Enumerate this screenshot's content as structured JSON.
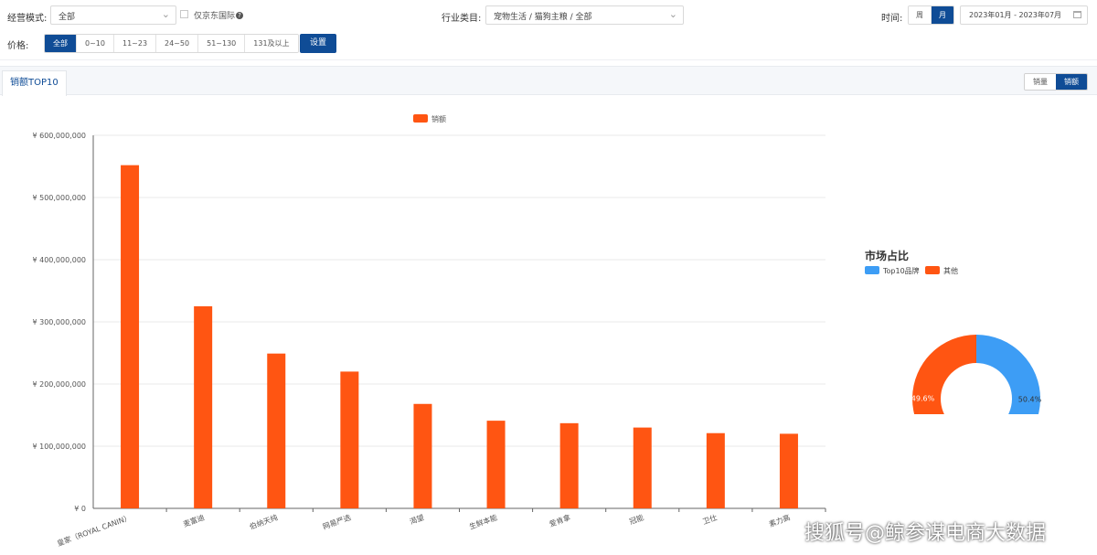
{
  "filters": {
    "mode_label": "经营模式:",
    "mode_value": "全部",
    "jd_intl_label": "仅京东国际",
    "industry_label": "行业类目:",
    "industry_value": "宠物生活 / 猫狗主粮 / 全部",
    "time_label": "时间:",
    "time_options": [
      "周",
      "月"
    ],
    "time_active": "月",
    "date_range": "2023年01月 - 2023年07月",
    "price_label": "价格:",
    "price_options": [
      "全部",
      "0~10",
      "11~23",
      "24~50",
      "51~130",
      "131及以上"
    ],
    "price_active": "全部",
    "set_button": "设置"
  },
  "panel": {
    "tab_label": "销额TOP10",
    "metric_options": [
      "销量",
      "销额"
    ],
    "metric_active": "销额"
  },
  "chart_data": [
    {
      "type": "bar",
      "legend": [
        "销额"
      ],
      "legend_position": "top-center",
      "categories": [
        "皇家（ROYAL CANIN）",
        "麦富迪",
        "伯纳天纯",
        "网易严选",
        "渴望",
        "生鲜本能",
        "爱肯拿",
        "冠能",
        "卫仕",
        "素力高"
      ],
      "series": [
        {
          "name": "销额",
          "values": [
            552000000,
            325000000,
            249000000,
            220000000,
            168000000,
            141000000,
            137000000,
            130000000,
            121000000,
            120000000
          ],
          "color": "#ff5512"
        }
      ],
      "ylim": [
        0,
        600000000
      ],
      "yticks": [
        0,
        100000000,
        200000000,
        300000000,
        400000000,
        500000000,
        600000000
      ],
      "ytick_labels": [
        "¥ 0",
        "¥ 100,000,000",
        "¥ 200,000,000",
        "¥ 300,000,000",
        "¥ 400,000,000",
        "¥ 500,000,000",
        "¥ 600,000,000"
      ],
      "grid": true
    },
    {
      "type": "pie",
      "title": "市场占比",
      "donut": true,
      "legend_position": "top-left",
      "labels": [
        "Top10品牌",
        "其他"
      ],
      "values": [
        50.4,
        49.6
      ],
      "value_labels": [
        "50.4%",
        "49.6%"
      ],
      "colors": [
        "#3d9df5",
        "#ff5512"
      ]
    }
  ],
  "watermark": "搜狐号@鲸参谋电商大数据"
}
